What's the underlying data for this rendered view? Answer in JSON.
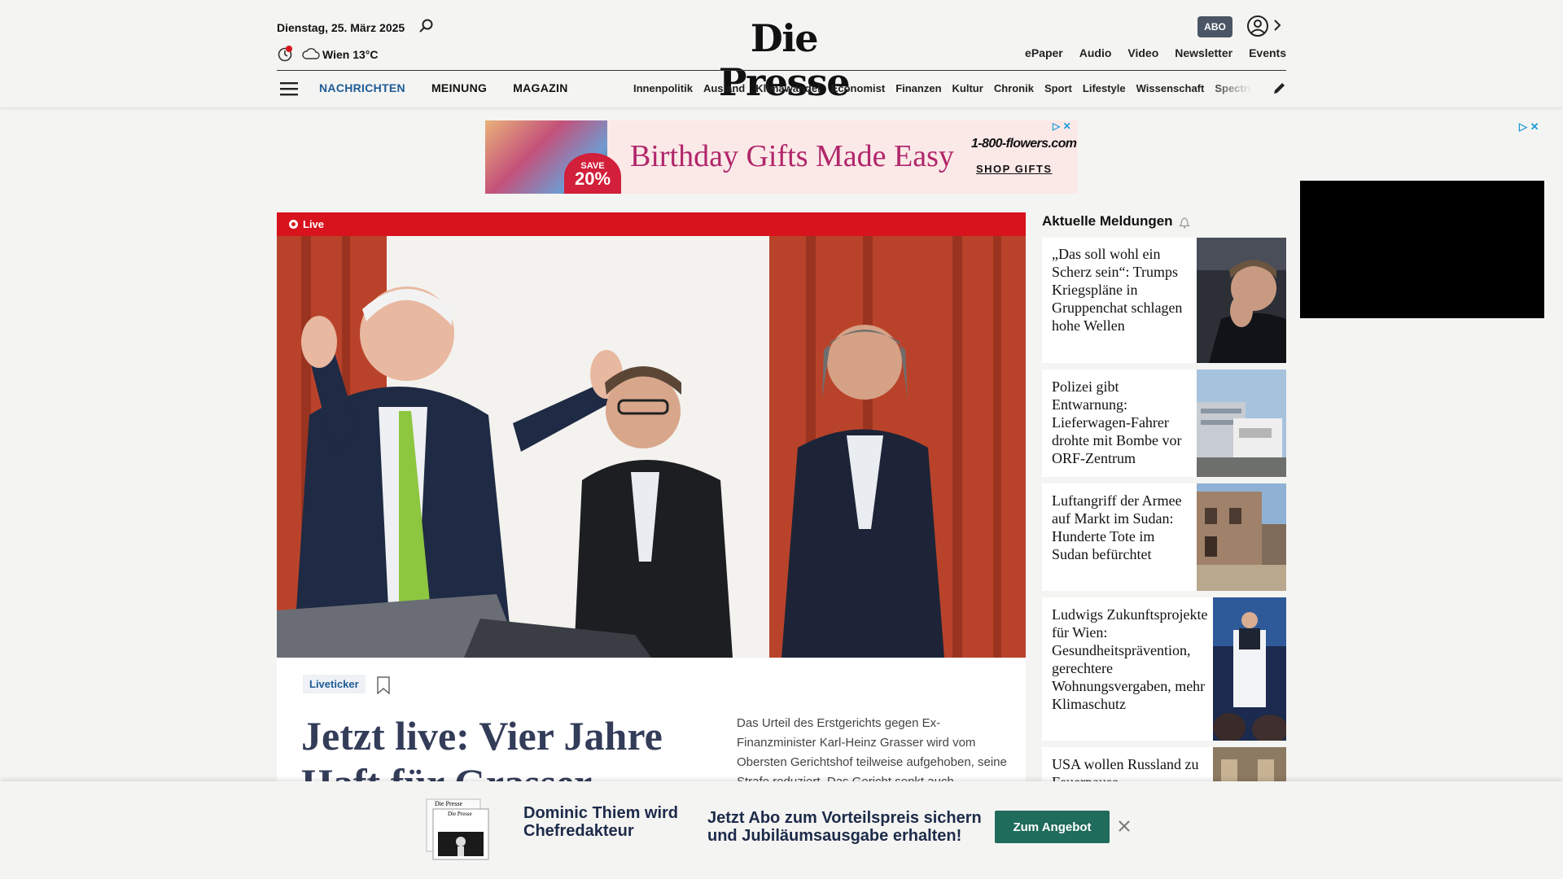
{
  "header": {
    "date": "Dienstag, 25. März 2025",
    "weather": "Wien 13°C",
    "logo": "Die Presse",
    "abo_badge": "ABO",
    "top_links": [
      "ePaper",
      "Audio",
      "Video",
      "Newsletter",
      "Events"
    ],
    "main_nav": [
      "NACHRICHTEN",
      "MEINUNG",
      "MAGAZIN"
    ],
    "sub_nav": [
      "Innenpolitik",
      "Ausland",
      "Klimawandel",
      "Economist",
      "Finanzen",
      "Kultur",
      "Chronik",
      "Sport",
      "Lifestyle",
      "Wissenschaft",
      "Spectrum"
    ]
  },
  "ad": {
    "save_line1": "SAVE",
    "save_line2": "20%",
    "headline": "Birthday Gifts Made Easy",
    "brand": "1-800-flowers.com",
    "cta": "SHOP GIFTS"
  },
  "hero": {
    "live_label": "Live",
    "kicker": "Liveticker",
    "title": "Jetzt live: Vier Jahre Haft für Grasser",
    "teaser": "Das Urteil des Erstgerichts gegen Ex-Finanzminister Karl-Heinz Grasser wird vom Obersten Gerichtshof teilweise aufgehoben, seine Strafe reduziert. Das Gericht senkt auch"
  },
  "aktuell": {
    "title": "Aktuelle Meldungen",
    "items": [
      {
        "title": "„Das soll wohl ein Scherz sein“: Trumps Kriegspläne in Gruppenchat schlagen hohe Wellen"
      },
      {
        "title": "Polizei gibt Entwarnung: Lieferwagen-Fahrer drohte mit Bombe vor ORF-Zentrum"
      },
      {
        "title": "Luftangriff der Armee auf Markt im Sudan: Hunderte Tote im Sudan befürchtet"
      },
      {
        "title": "Ludwigs Zukunftsprojekte für Wien: Gesundheitsprävention, gerechtere Wohnungsvergaben, mehr Klimaschutz"
      },
      {
        "title": "USA wollen Russland zu Feuerpause"
      }
    ]
  },
  "promo": {
    "headline": "Dominic Thiem wird Chefredakteur",
    "text": "Jetzt Abo zum Vorteilspreis sichern und Jubiläumsausgabe erhalten!",
    "button": "Zum Angebot",
    "paper_brand": "Die Presse"
  }
}
